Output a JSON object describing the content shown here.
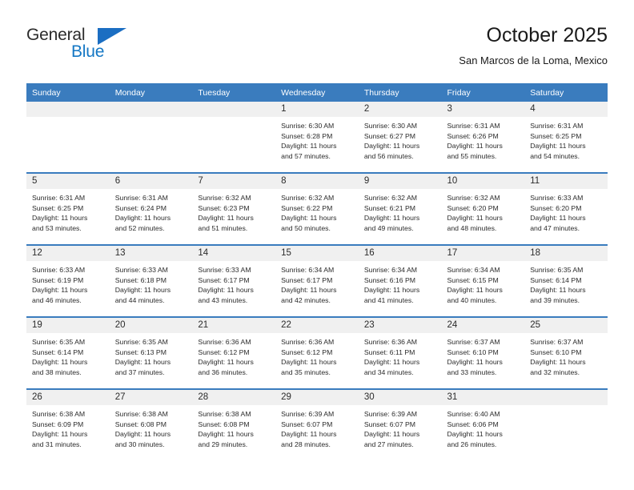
{
  "brand": {
    "name_part1": "General",
    "name_part2": "Blue",
    "triangle_icon": "triangle-logo-icon"
  },
  "header": {
    "title": "October 2025",
    "subtitle": "San Marcos de la Loma, Mexico"
  },
  "calendar": {
    "weekday_headers": [
      "Sunday",
      "Monday",
      "Tuesday",
      "Wednesday",
      "Thursday",
      "Friday",
      "Saturday"
    ],
    "accent_color": "#3a7cbe",
    "daynum_band_color": "#f0f0f0",
    "weeks": [
      [
        {
          "day": "",
          "lines": []
        },
        {
          "day": "",
          "lines": []
        },
        {
          "day": "",
          "lines": []
        },
        {
          "day": "1",
          "lines": [
            "Sunrise: 6:30 AM",
            "Sunset: 6:28 PM",
            "Daylight: 11 hours",
            "and 57 minutes."
          ]
        },
        {
          "day": "2",
          "lines": [
            "Sunrise: 6:30 AM",
            "Sunset: 6:27 PM",
            "Daylight: 11 hours",
            "and 56 minutes."
          ]
        },
        {
          "day": "3",
          "lines": [
            "Sunrise: 6:31 AM",
            "Sunset: 6:26 PM",
            "Daylight: 11 hours",
            "and 55 minutes."
          ]
        },
        {
          "day": "4",
          "lines": [
            "Sunrise: 6:31 AM",
            "Sunset: 6:25 PM",
            "Daylight: 11 hours",
            "and 54 minutes."
          ]
        }
      ],
      [
        {
          "day": "5",
          "lines": [
            "Sunrise: 6:31 AM",
            "Sunset: 6:25 PM",
            "Daylight: 11 hours",
            "and 53 minutes."
          ]
        },
        {
          "day": "6",
          "lines": [
            "Sunrise: 6:31 AM",
            "Sunset: 6:24 PM",
            "Daylight: 11 hours",
            "and 52 minutes."
          ]
        },
        {
          "day": "7",
          "lines": [
            "Sunrise: 6:32 AM",
            "Sunset: 6:23 PM",
            "Daylight: 11 hours",
            "and 51 minutes."
          ]
        },
        {
          "day": "8",
          "lines": [
            "Sunrise: 6:32 AM",
            "Sunset: 6:22 PM",
            "Daylight: 11 hours",
            "and 50 minutes."
          ]
        },
        {
          "day": "9",
          "lines": [
            "Sunrise: 6:32 AM",
            "Sunset: 6:21 PM",
            "Daylight: 11 hours",
            "and 49 minutes."
          ]
        },
        {
          "day": "10",
          "lines": [
            "Sunrise: 6:32 AM",
            "Sunset: 6:20 PM",
            "Daylight: 11 hours",
            "and 48 minutes."
          ]
        },
        {
          "day": "11",
          "lines": [
            "Sunrise: 6:33 AM",
            "Sunset: 6:20 PM",
            "Daylight: 11 hours",
            "and 47 minutes."
          ]
        }
      ],
      [
        {
          "day": "12",
          "lines": [
            "Sunrise: 6:33 AM",
            "Sunset: 6:19 PM",
            "Daylight: 11 hours",
            "and 46 minutes."
          ]
        },
        {
          "day": "13",
          "lines": [
            "Sunrise: 6:33 AM",
            "Sunset: 6:18 PM",
            "Daylight: 11 hours",
            "and 44 minutes."
          ]
        },
        {
          "day": "14",
          "lines": [
            "Sunrise: 6:33 AM",
            "Sunset: 6:17 PM",
            "Daylight: 11 hours",
            "and 43 minutes."
          ]
        },
        {
          "day": "15",
          "lines": [
            "Sunrise: 6:34 AM",
            "Sunset: 6:17 PM",
            "Daylight: 11 hours",
            "and 42 minutes."
          ]
        },
        {
          "day": "16",
          "lines": [
            "Sunrise: 6:34 AM",
            "Sunset: 6:16 PM",
            "Daylight: 11 hours",
            "and 41 minutes."
          ]
        },
        {
          "day": "17",
          "lines": [
            "Sunrise: 6:34 AM",
            "Sunset: 6:15 PM",
            "Daylight: 11 hours",
            "and 40 minutes."
          ]
        },
        {
          "day": "18",
          "lines": [
            "Sunrise: 6:35 AM",
            "Sunset: 6:14 PM",
            "Daylight: 11 hours",
            "and 39 minutes."
          ]
        }
      ],
      [
        {
          "day": "19",
          "lines": [
            "Sunrise: 6:35 AM",
            "Sunset: 6:14 PM",
            "Daylight: 11 hours",
            "and 38 minutes."
          ]
        },
        {
          "day": "20",
          "lines": [
            "Sunrise: 6:35 AM",
            "Sunset: 6:13 PM",
            "Daylight: 11 hours",
            "and 37 minutes."
          ]
        },
        {
          "day": "21",
          "lines": [
            "Sunrise: 6:36 AM",
            "Sunset: 6:12 PM",
            "Daylight: 11 hours",
            "and 36 minutes."
          ]
        },
        {
          "day": "22",
          "lines": [
            "Sunrise: 6:36 AM",
            "Sunset: 6:12 PM",
            "Daylight: 11 hours",
            "and 35 minutes."
          ]
        },
        {
          "day": "23",
          "lines": [
            "Sunrise: 6:36 AM",
            "Sunset: 6:11 PM",
            "Daylight: 11 hours",
            "and 34 minutes."
          ]
        },
        {
          "day": "24",
          "lines": [
            "Sunrise: 6:37 AM",
            "Sunset: 6:10 PM",
            "Daylight: 11 hours",
            "and 33 minutes."
          ]
        },
        {
          "day": "25",
          "lines": [
            "Sunrise: 6:37 AM",
            "Sunset: 6:10 PM",
            "Daylight: 11 hours",
            "and 32 minutes."
          ]
        }
      ],
      [
        {
          "day": "26",
          "lines": [
            "Sunrise: 6:38 AM",
            "Sunset: 6:09 PM",
            "Daylight: 11 hours",
            "and 31 minutes."
          ]
        },
        {
          "day": "27",
          "lines": [
            "Sunrise: 6:38 AM",
            "Sunset: 6:08 PM",
            "Daylight: 11 hours",
            "and 30 minutes."
          ]
        },
        {
          "day": "28",
          "lines": [
            "Sunrise: 6:38 AM",
            "Sunset: 6:08 PM",
            "Daylight: 11 hours",
            "and 29 minutes."
          ]
        },
        {
          "day": "29",
          "lines": [
            "Sunrise: 6:39 AM",
            "Sunset: 6:07 PM",
            "Daylight: 11 hours",
            "and 28 minutes."
          ]
        },
        {
          "day": "30",
          "lines": [
            "Sunrise: 6:39 AM",
            "Sunset: 6:07 PM",
            "Daylight: 11 hours",
            "and 27 minutes."
          ]
        },
        {
          "day": "31",
          "lines": [
            "Sunrise: 6:40 AM",
            "Sunset: 6:06 PM",
            "Daylight: 11 hours",
            "and 26 minutes."
          ]
        },
        {
          "day": "",
          "lines": []
        }
      ]
    ]
  }
}
